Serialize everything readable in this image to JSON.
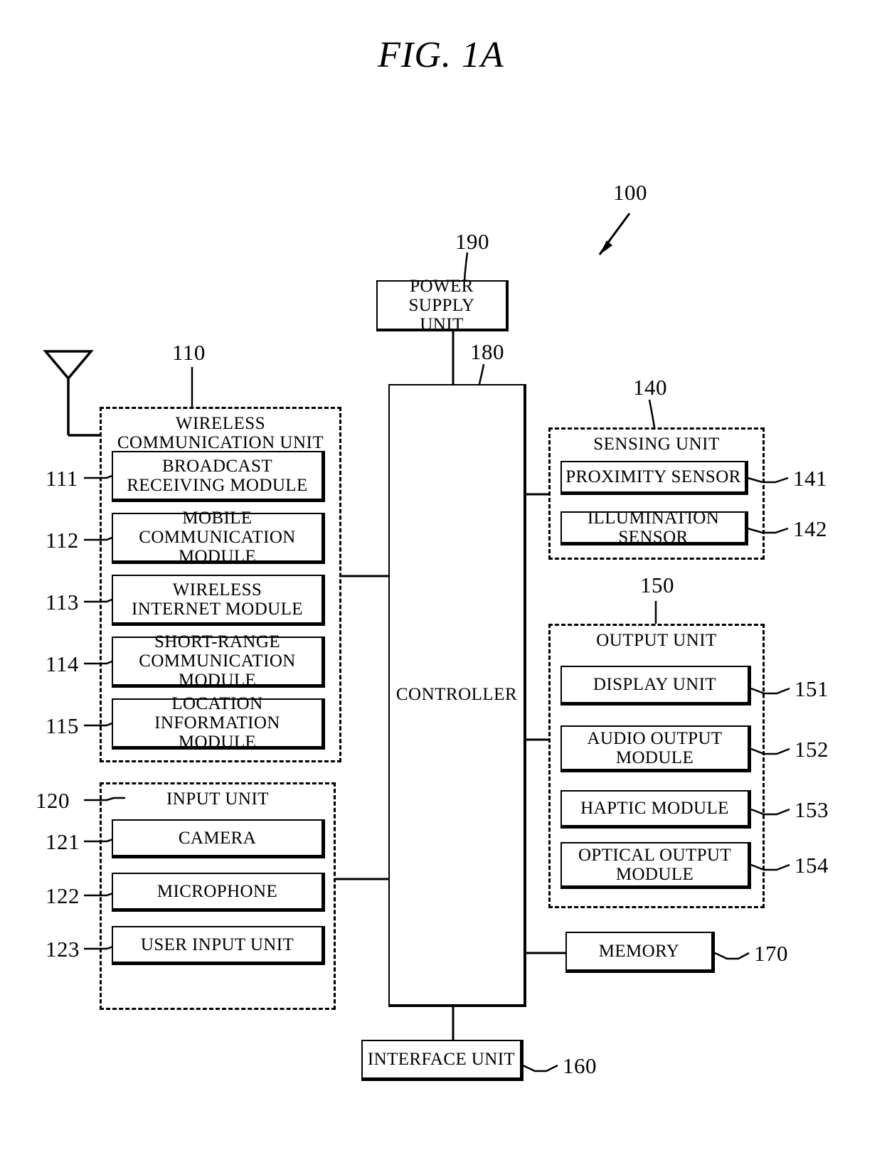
{
  "figure": {
    "title": "FIG. 1A",
    "device_ref": "100"
  },
  "power_supply": {
    "label": "POWER SUPPLY\nUNIT",
    "ref": "190"
  },
  "controller": {
    "label": "CONTROLLER",
    "ref": "180"
  },
  "wireless_communication_unit": {
    "title": "WIRELESS\nCOMMUNICATION UNIT",
    "ref": "110",
    "modules": [
      {
        "label": "BROADCAST\nRECEIVING MODULE",
        "ref": "111"
      },
      {
        "label": "MOBILE\nCOMMUNICATION MODULE",
        "ref": "112"
      },
      {
        "label": "WIRELESS\nINTERNET MODULE",
        "ref": "113"
      },
      {
        "label": "SHORT-RANGE\nCOMMUNICATION MODULE",
        "ref": "114"
      },
      {
        "label": "LOCATION\nINFORMATION MODULE",
        "ref": "115"
      }
    ]
  },
  "input_unit": {
    "title": "INPUT UNIT",
    "ref": "120",
    "modules": [
      {
        "label": "CAMERA",
        "ref": "121"
      },
      {
        "label": "MICROPHONE",
        "ref": "122"
      },
      {
        "label": "USER INPUT UNIT",
        "ref": "123"
      }
    ]
  },
  "sensing_unit": {
    "title": "SENSING UNIT",
    "ref": "140",
    "modules": [
      {
        "label": "PROXIMITY SENSOR",
        "ref": "141"
      },
      {
        "label": "ILLUMINATION SENSOR",
        "ref": "142"
      }
    ]
  },
  "output_unit": {
    "title": "OUTPUT UNIT",
    "ref": "150",
    "modules": [
      {
        "label": "DISPLAY UNIT",
        "ref": "151"
      },
      {
        "label": "AUDIO OUTPUT\nMODULE",
        "ref": "152"
      },
      {
        "label": "HAPTIC MODULE",
        "ref": "153"
      },
      {
        "label": "OPTICAL OUTPUT\nMODULE",
        "ref": "154"
      }
    ]
  },
  "memory": {
    "label": "MEMORY",
    "ref": "170"
  },
  "interface_unit": {
    "label": "INTERFACE UNIT",
    "ref": "160"
  },
  "antenna": {
    "name": "antenna-symbol"
  }
}
